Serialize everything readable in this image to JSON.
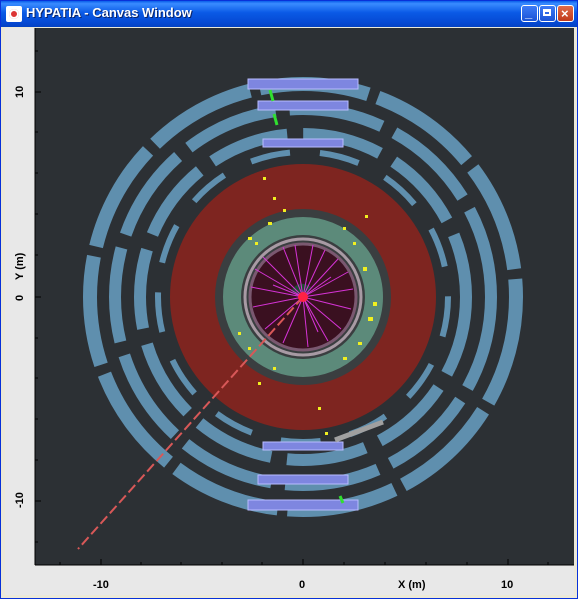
{
  "window": {
    "title": "HYPATIA - Canvas Window",
    "buttons": {
      "minimize": "_",
      "maximize": "",
      "close": "×"
    }
  },
  "colors": {
    "background": "#2c3034",
    "muon_chamber": "#5f8fae",
    "muon_chamber_blue": "#7e86e0",
    "hadronic_calorimeter": "#7e2520",
    "em_calorimeter": "#5c8a7a",
    "inner_detector": "#3a1020",
    "tracks": "#d633d6",
    "hits": "#f0f020",
    "vertex": "#ff2244",
    "missing_et": "#d85858"
  },
  "axes": {
    "x_label": "X (m)",
    "y_label": "Y (m)",
    "x_ticks": [
      "-10",
      "0",
      "10"
    ],
    "y_ticks": [
      "10",
      "0",
      "-10"
    ]
  }
}
